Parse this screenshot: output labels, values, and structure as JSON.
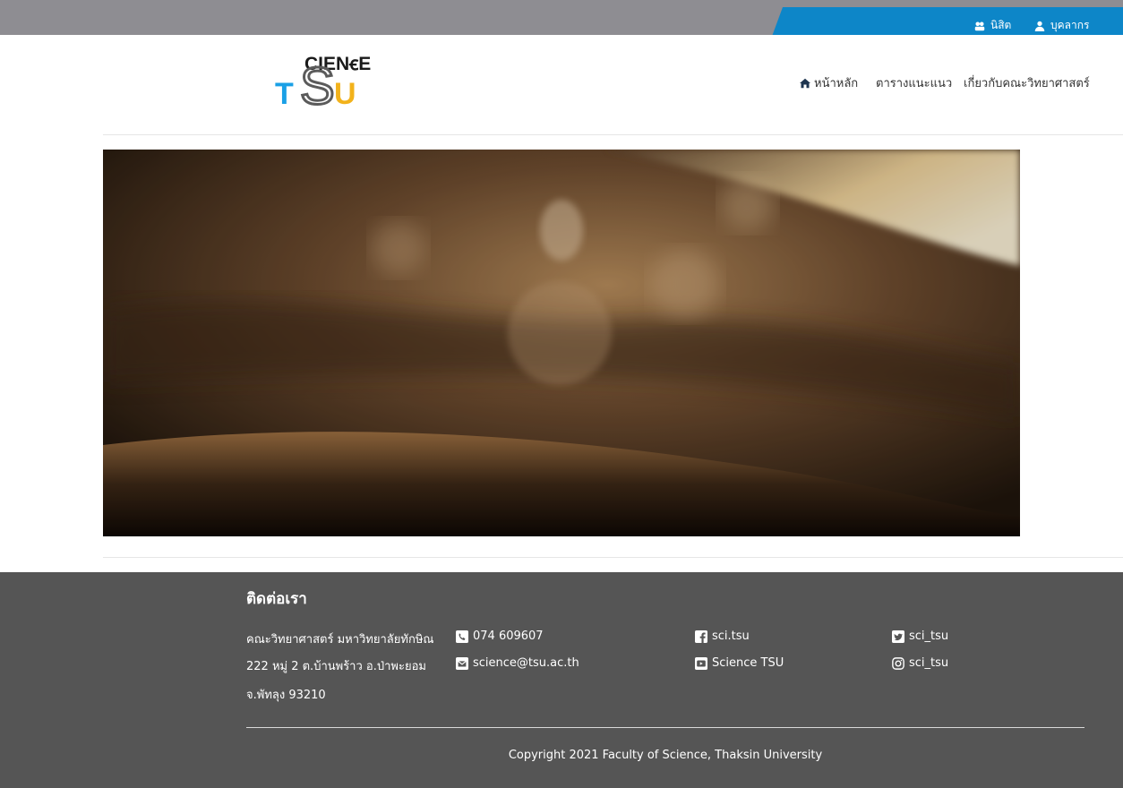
{
  "topbar": {
    "student_link": "นิสิต",
    "staff_link": "บุคลากร",
    "accent_color": "#0d86c8"
  },
  "header": {
    "logo_top": "CIENꞓE",
    "logo_bottom_t": "T",
    "logo_bottom_s": "S",
    "logo_bottom_u": "U",
    "nav": {
      "home": "หน้าหลัก",
      "schedule": "ตารางแนะแนว",
      "about": "เกี่ยวกับคณะวิทยาศาสตร์"
    }
  },
  "footer": {
    "title": "ติดต่อเรา",
    "address": [
      "คณะวิทยาศาสตร์ มหาวิทยาลัยทักษิณ",
      "222 หมู่ 2 ต.บ้านพร้าว อ.ป่าพะยอม",
      "จ.พัทลุง 93210"
    ],
    "phone": "074 609607",
    "email": "science@tsu.ac.th",
    "facebook": "sci.tsu",
    "youtube": "Science TSU",
    "twitter": "sci_tsu",
    "instagram": "sci_tsu",
    "copyright": "Copyright 2021 Faculty of Science, Thaksin University"
  }
}
